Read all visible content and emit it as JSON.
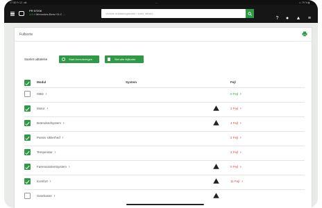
{
  "statusbar": {
    "time": "17:38 Fr 12. okt",
    "center": "...",
    "right": "• • 79 % ▮"
  },
  "vehicle": {
    "reg": "PR 57208",
    "code": "1.6 d",
    "model": "Mercedes-Benz GLC ..."
  },
  "search": {
    "placeholder": "Vehicle erstatningskoder / ruter, diesel..."
  },
  "card": {
    "title": "Fullsorte"
  },
  "settings": {
    "label": "Samlet udtalelse",
    "btn_start": "Start formuleringen",
    "btn_clear": "Slet alle fejlkoder"
  },
  "table": {
    "headers": {
      "module": "Modul",
      "system": "System",
      "faults": "Fejl"
    },
    "rows": [
      {
        "name": "OBD",
        "checked": false,
        "warn": false,
        "fault": "0 Fejl",
        "status": "ok"
      },
      {
        "name": "Motor",
        "checked": true,
        "warn": true,
        "fault": "2 Fejl",
        "status": "bad"
      },
      {
        "name": "Brændstofsystem",
        "checked": true,
        "warn": true,
        "fault": "4 Fejl",
        "status": "bad"
      },
      {
        "name": "Passiv sikkerhed",
        "checked": true,
        "warn": false,
        "fault": "2 Fejl",
        "status": "bad"
      },
      {
        "name": "Temperatur",
        "checked": true,
        "warn": false,
        "fault": "2 Fejl",
        "status": "bad"
      },
      {
        "name": "Førerassistentsystem",
        "checked": true,
        "warn": true,
        "fault": "0 Fejl",
        "status": "bad"
      },
      {
        "name": "Komfort",
        "checked": true,
        "warn": true,
        "fault": "11 Fejl",
        "status": "bad"
      },
      {
        "name": "Gearkasse",
        "checked": false,
        "warn": true,
        "fault": "",
        "status": "none"
      }
    ]
  },
  "colors": {
    "accent": "#2e9a45",
    "error": "#d7443d",
    "appbar": "#161616"
  }
}
